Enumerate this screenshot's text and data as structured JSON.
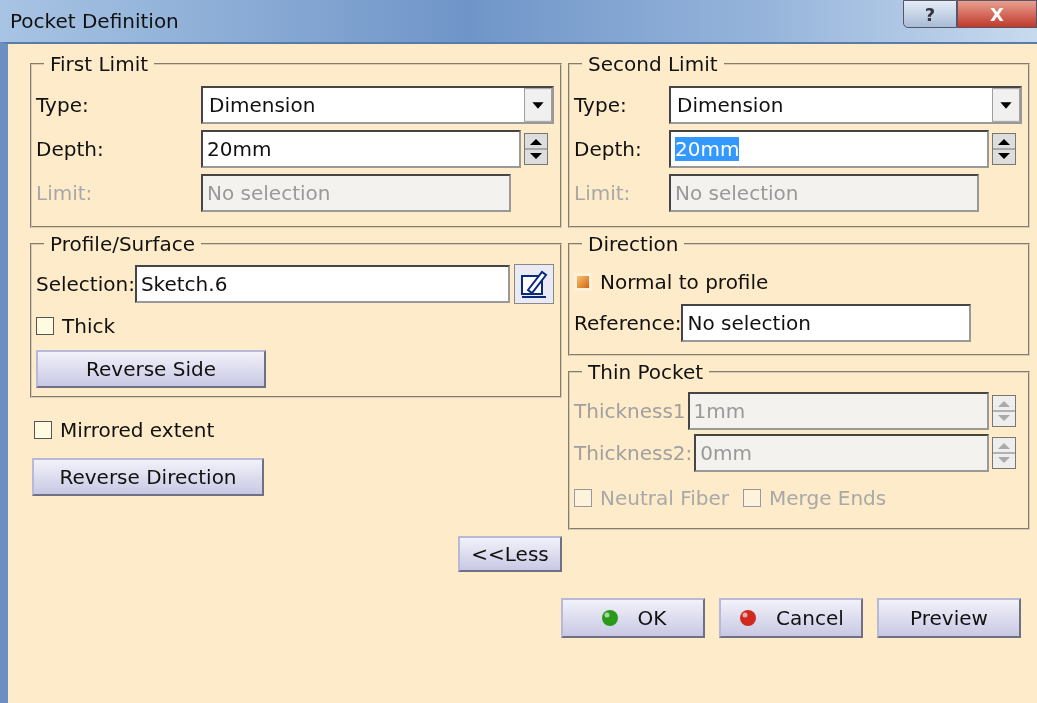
{
  "window": {
    "title": "Pocket Definition",
    "help_button": "?",
    "close_button": "X"
  },
  "first_limit": {
    "title": "First Limit",
    "fields": [
      {
        "kind": "combo",
        "label": "Type:",
        "value": "Dimension",
        "disabled": false
      },
      {
        "kind": "spin",
        "label": "Depth:",
        "value": "20mm",
        "disabled": false
      },
      {
        "kind": "text",
        "label": "Limit:",
        "value": "No selection",
        "disabled": true
      }
    ]
  },
  "second_limit": {
    "title": "Second Limit",
    "fields": [
      {
        "kind": "combo",
        "label": "Type:",
        "value": "Dimension",
        "disabled": false
      },
      {
        "kind": "spin",
        "label": "Depth:",
        "value": "20mm",
        "disabled": false,
        "text_selected": true
      },
      {
        "kind": "text",
        "label": "Limit:",
        "value": "No selection",
        "disabled": true
      }
    ]
  },
  "profile_surface": {
    "title": "Profile/Surface",
    "selection_label": "Selection:",
    "selection_value": "Sketch.6",
    "thick": {
      "label": "Thick",
      "checked": false
    },
    "reverse_side": "Reverse Side"
  },
  "mirrored_extent": {
    "label": "Mirrored extent",
    "checked": false
  },
  "reverse_direction": "Reverse Direction",
  "less_button": "<<Less",
  "direction": {
    "title": "Direction",
    "normal_to_profile": {
      "label": "Normal to profile",
      "checked": true
    },
    "reference_label": "Reference:",
    "reference_value": "No selection"
  },
  "thin_pocket": {
    "title": "Thin Pocket",
    "fields": [
      {
        "kind": "spin",
        "label": "Thickness1",
        "value": "1mm",
        "disabled": true
      },
      {
        "kind": "spin",
        "label": "Thickness2:",
        "value": "0mm",
        "disabled": true
      }
    ],
    "options": [
      {
        "label": "Neutral Fiber",
        "checked": false,
        "disabled": true
      },
      {
        "label": "Merge Ends",
        "checked": false,
        "disabled": true
      }
    ]
  },
  "buttons": [
    {
      "kind": "ok",
      "label": "OK"
    },
    {
      "kind": "cancel",
      "label": "Cancel"
    },
    {
      "kind": "plain",
      "label": "Preview"
    }
  ]
}
